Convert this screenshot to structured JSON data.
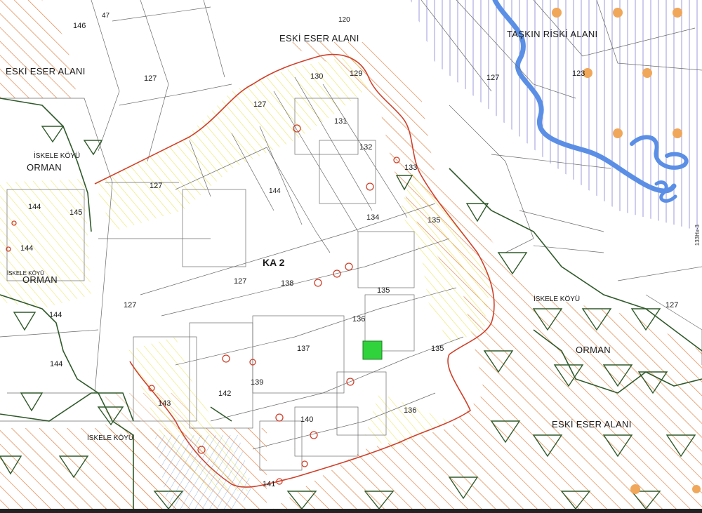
{
  "map": {
    "zone_label": "KA 2",
    "side_code": "133Hx-3",
    "labels": {
      "eski_eser_1": "ESKİ ESER ALANI",
      "eski_eser_2": "ESKİ ESER ALANI",
      "eski_eser_3": "ESKİ ESER ALANI",
      "taskin": "TAŞKIN RİSKİ ALANI",
      "iskele_koyu_1": "İSKELE KÖYÜ",
      "iskele_koyu_2": "İSKELE KÖYÜ",
      "iskele_koyu_3": "İSKELE KÖYÜ",
      "iskele_koyu_4": "İSKELE KÖYÜ",
      "orman_1": "ORMAN",
      "orman_2": "ORMAN",
      "orman_3": "ORMAN"
    },
    "blocks": {
      "b146": "146",
      "b47": "47",
      "b120": "120",
      "b127a": "127",
      "b130": "130",
      "b129": "129",
      "b127b": "127",
      "b131": "131",
      "b132": "132",
      "b133": "133",
      "b134": "134",
      "b135a": "135",
      "b127c": "127",
      "b123": "123",
      "b127d": "127",
      "b144a": "144",
      "b145": "145",
      "b144b": "144",
      "b144c": "144",
      "b144d": "144",
      "b127e": "127",
      "b138": "138",
      "b135b": "135",
      "b136a": "136",
      "b137": "137",
      "b135c": "135",
      "b139": "139",
      "b142": "142",
      "b143": "143",
      "b140": "140",
      "b141": "141",
      "b136b": "136",
      "b127f": "127",
      "b127g": "127",
      "b144e": "144"
    },
    "colors": {
      "heritage_hatch": "#e07a3a",
      "forest": "#2f5a2a",
      "flood_hatch": "#8a86d8",
      "river": "#5b8fe6",
      "zone_boundary": "#d0402a",
      "yellow_hatch": "#e6e34a",
      "highlight_parcel": "#31d33c",
      "marker": "#f0a75a"
    }
  }
}
